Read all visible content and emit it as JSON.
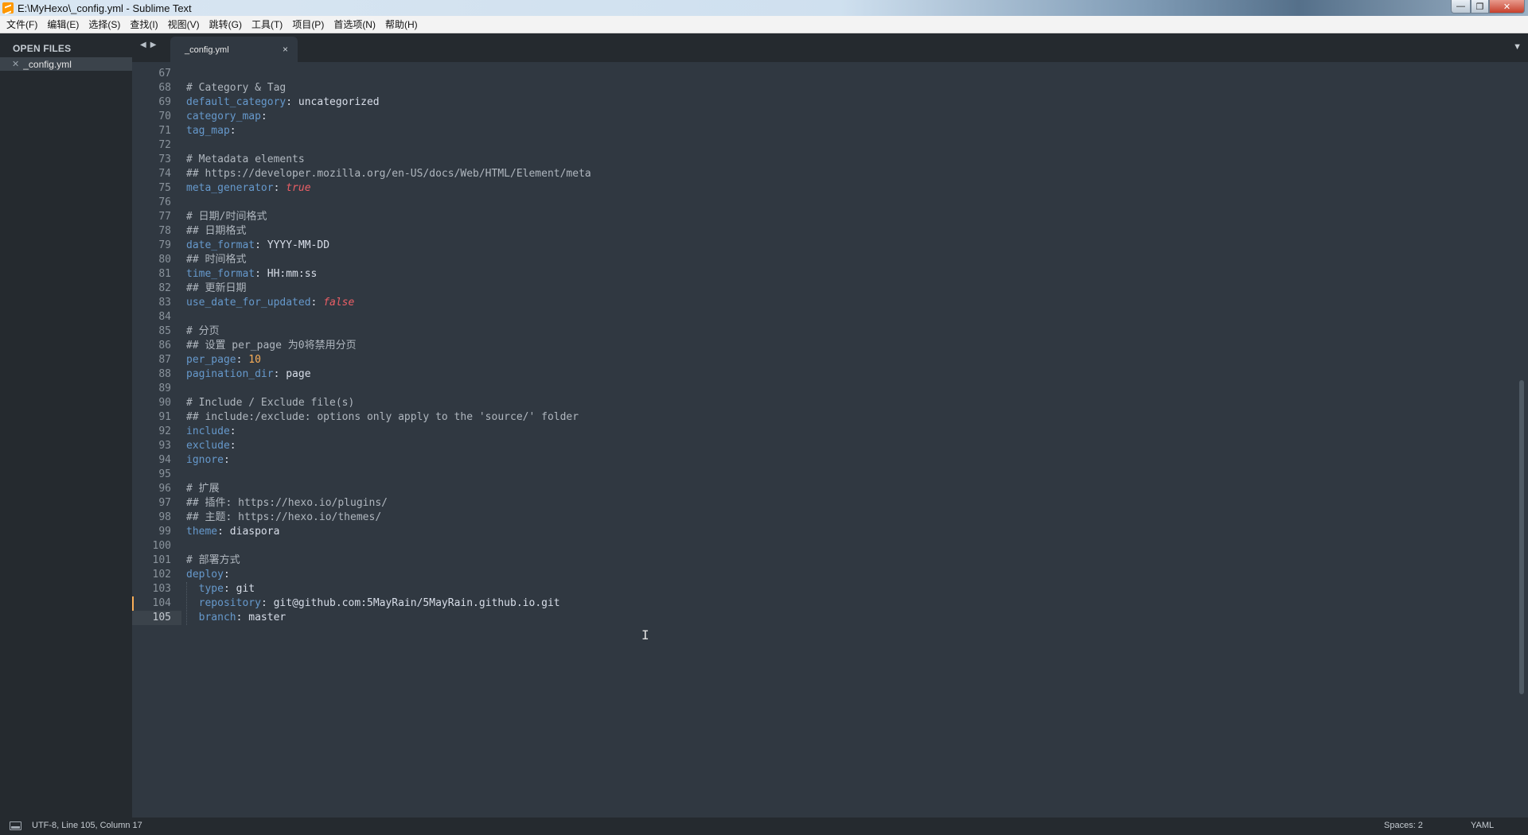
{
  "window": {
    "title": "E:\\MyHexo\\_config.yml - Sublime Text",
    "controls": {
      "minimize": "—",
      "maximize": "❐",
      "close": "✕"
    }
  },
  "menu": [
    "文件(F)",
    "编辑(E)",
    "选择(S)",
    "查找(I)",
    "视图(V)",
    "跳转(G)",
    "工具(T)",
    "项目(P)",
    "首选项(N)",
    "帮助(H)"
  ],
  "sidebar": {
    "header": "OPEN FILES",
    "files": [
      {
        "name": "_config.yml",
        "close": "✕"
      }
    ]
  },
  "tabs": {
    "nav_back": "◀",
    "nav_forward": "▶",
    "active": {
      "label": "_config.yml",
      "close": "×"
    },
    "dropdown": "▼"
  },
  "editor": {
    "current_line": 105,
    "modified_line": 104,
    "cursor_glyph": "I",
    "lines": [
      {
        "n": "67",
        "tokens": []
      },
      {
        "n": "68",
        "tokens": [
          {
            "t": "comment",
            "s": "# Category & Tag"
          }
        ]
      },
      {
        "n": "69",
        "tokens": [
          {
            "t": "key",
            "s": "default_category"
          },
          {
            "t": "punct",
            "s": ": "
          },
          {
            "t": "value",
            "s": "uncategorized"
          }
        ]
      },
      {
        "n": "70",
        "tokens": [
          {
            "t": "key",
            "s": "category_map"
          },
          {
            "t": "punct",
            "s": ":"
          }
        ]
      },
      {
        "n": "71",
        "tokens": [
          {
            "t": "key",
            "s": "tag_map"
          },
          {
            "t": "punct",
            "s": ":"
          }
        ]
      },
      {
        "n": "72",
        "tokens": []
      },
      {
        "n": "73",
        "tokens": [
          {
            "t": "comment",
            "s": "# Metadata elements"
          }
        ]
      },
      {
        "n": "74",
        "tokens": [
          {
            "t": "comment",
            "s": "## https://developer.mozilla.org/en-US/docs/Web/HTML/Element/meta"
          }
        ]
      },
      {
        "n": "75",
        "tokens": [
          {
            "t": "key",
            "s": "meta_generator"
          },
          {
            "t": "punct",
            "s": ": "
          },
          {
            "t": "bool",
            "s": "true"
          }
        ]
      },
      {
        "n": "76",
        "tokens": []
      },
      {
        "n": "77",
        "tokens": [
          {
            "t": "comment",
            "s": "# 日期/时间格式"
          }
        ]
      },
      {
        "n": "78",
        "tokens": [
          {
            "t": "comment",
            "s": "## 日期格式"
          }
        ]
      },
      {
        "n": "79",
        "tokens": [
          {
            "t": "key",
            "s": "date_format"
          },
          {
            "t": "punct",
            "s": ": "
          },
          {
            "t": "value",
            "s": "YYYY-MM-DD"
          }
        ]
      },
      {
        "n": "80",
        "tokens": [
          {
            "t": "comment",
            "s": "## 时间格式"
          }
        ]
      },
      {
        "n": "81",
        "tokens": [
          {
            "t": "key",
            "s": "time_format"
          },
          {
            "t": "punct",
            "s": ": "
          },
          {
            "t": "value",
            "s": "HH:mm:ss"
          }
        ]
      },
      {
        "n": "82",
        "tokens": [
          {
            "t": "comment",
            "s": "## 更新日期"
          }
        ]
      },
      {
        "n": "83",
        "tokens": [
          {
            "t": "key",
            "s": "use_date_for_updated"
          },
          {
            "t": "punct",
            "s": ": "
          },
          {
            "t": "bool",
            "s": "false"
          }
        ]
      },
      {
        "n": "84",
        "tokens": []
      },
      {
        "n": "85",
        "tokens": [
          {
            "t": "comment",
            "s": "# 分页"
          }
        ]
      },
      {
        "n": "86",
        "tokens": [
          {
            "t": "comment",
            "s": "## 设置 per_page 为0将禁用分页"
          }
        ]
      },
      {
        "n": "87",
        "tokens": [
          {
            "t": "key",
            "s": "per_page"
          },
          {
            "t": "punct",
            "s": ": "
          },
          {
            "t": "num",
            "s": "10"
          }
        ]
      },
      {
        "n": "88",
        "tokens": [
          {
            "t": "key",
            "s": "pagination_dir"
          },
          {
            "t": "punct",
            "s": ": "
          },
          {
            "t": "value",
            "s": "page"
          }
        ]
      },
      {
        "n": "89",
        "tokens": []
      },
      {
        "n": "90",
        "tokens": [
          {
            "t": "comment",
            "s": "# Include / Exclude file(s)"
          }
        ]
      },
      {
        "n": "91",
        "tokens": [
          {
            "t": "comment",
            "s": "## include:/exclude: options only apply to the 'source/' folder"
          }
        ]
      },
      {
        "n": "92",
        "tokens": [
          {
            "t": "key",
            "s": "include"
          },
          {
            "t": "punct",
            "s": ":"
          }
        ]
      },
      {
        "n": "93",
        "tokens": [
          {
            "t": "key",
            "s": "exclude"
          },
          {
            "t": "punct",
            "s": ":"
          }
        ]
      },
      {
        "n": "94",
        "tokens": [
          {
            "t": "key",
            "s": "ignore"
          },
          {
            "t": "punct",
            "s": ":"
          }
        ]
      },
      {
        "n": "95",
        "tokens": []
      },
      {
        "n": "96",
        "tokens": [
          {
            "t": "comment",
            "s": "# 扩展"
          }
        ]
      },
      {
        "n": "97",
        "tokens": [
          {
            "t": "comment",
            "s": "## 插件: https://hexo.io/plugins/"
          }
        ]
      },
      {
        "n": "98",
        "tokens": [
          {
            "t": "comment",
            "s": "## 主题: https://hexo.io/themes/"
          }
        ]
      },
      {
        "n": "99",
        "tokens": [
          {
            "t": "key",
            "s": "theme"
          },
          {
            "t": "punct",
            "s": ": "
          },
          {
            "t": "value",
            "s": "diaspora"
          }
        ]
      },
      {
        "n": "100",
        "tokens": []
      },
      {
        "n": "101",
        "tokens": [
          {
            "t": "comment",
            "s": "# 部署方式"
          }
        ]
      },
      {
        "n": "102",
        "tokens": [
          {
            "t": "key",
            "s": "deploy"
          },
          {
            "t": "punct",
            "s": ":"
          }
        ]
      },
      {
        "n": "103",
        "tokens": [
          {
            "t": "punct",
            "s": "  "
          },
          {
            "t": "key",
            "s": "type"
          },
          {
            "t": "punct",
            "s": ": "
          },
          {
            "t": "value",
            "s": "git"
          }
        ]
      },
      {
        "n": "104",
        "tokens": [
          {
            "t": "punct",
            "s": "  "
          },
          {
            "t": "key",
            "s": "repository"
          },
          {
            "t": "punct",
            "s": ": "
          },
          {
            "t": "value",
            "s": "git@github.com:5MayRain/5MayRain.github.io.git"
          }
        ]
      },
      {
        "n": "105",
        "tokens": [
          {
            "t": "punct",
            "s": "  "
          },
          {
            "t": "key",
            "s": "branch"
          },
          {
            "t": "punct",
            "s": ": "
          },
          {
            "t": "value",
            "s": "master"
          }
        ]
      }
    ]
  },
  "colors": {
    "editor_bg": "#303841",
    "sidebar_bg": "#252a2f",
    "comment": "#b0b7bf",
    "key": "#6699cc",
    "bool": "#ec5f66",
    "number": "#f9ae58",
    "modified_marker": "#f9ae58"
  },
  "status": {
    "left": "UTF-8, Line 105, Column 17",
    "spaces": "Spaces: 2",
    "syntax": "YAML"
  }
}
